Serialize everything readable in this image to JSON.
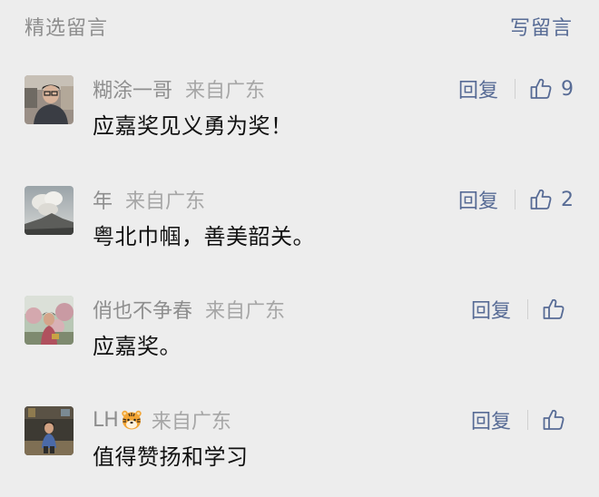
{
  "header": {
    "title": "精选留言",
    "write_label": "写留言"
  },
  "comments": [
    {
      "nickname": "糊涂一哥",
      "location": "来自广东",
      "content": "应嘉奖见义勇为奖！",
      "reply_label": "回复",
      "likes": "9"
    },
    {
      "nickname": "年",
      "location": "来自广东",
      "content": "粤北巾帼，善美韶关。",
      "reply_label": "回复",
      "likes": "2"
    },
    {
      "nickname": "俏也不争春",
      "location": "来自广东",
      "content": "应嘉奖。",
      "reply_label": "回复",
      "likes": ""
    },
    {
      "nickname": "LH",
      "nickname_emoji": "tiger-face-emoji",
      "location": "来自广东",
      "content": "值得赞扬和学习",
      "reply_label": "回复",
      "likes": ""
    }
  ],
  "icons": {
    "like": "thumbs-up-icon"
  },
  "colors": {
    "link": "#576b95",
    "muted": "#8e8e8e",
    "background": "#ededed",
    "text": "#111111"
  }
}
